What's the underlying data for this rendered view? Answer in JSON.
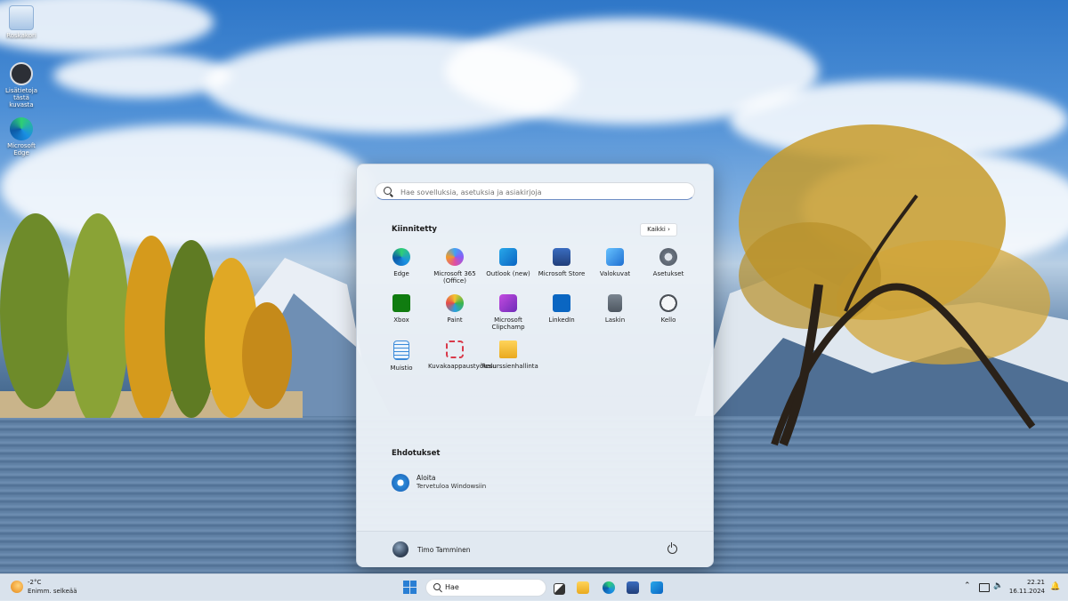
{
  "desktop": {
    "icons": [
      {
        "label": "Roskakori",
        "icon": "recycle-bin-icon"
      },
      {
        "label": "Lisätietoja tästä kuvasta",
        "icon": "info-camera-icon"
      },
      {
        "label": "Microsoft Edge",
        "icon": "edge-icon"
      }
    ]
  },
  "start_menu": {
    "search_placeholder": "Hae sovelluksia, asetuksia ja asiakirjoja",
    "pinned_title": "Kiinnitetty",
    "all_button": "Kaikki  ›",
    "pinned": [
      {
        "label": "Edge",
        "icon": "edge-icon",
        "color": "#1f8fe0"
      },
      {
        "label": "Microsoft 365 (Office)",
        "icon": "office-icon",
        "color": "#8a5cf6"
      },
      {
        "label": "Outlook (new)",
        "icon": "outlook-icon",
        "color": "#0a64c2"
      },
      {
        "label": "Microsoft Store",
        "icon": "store-icon",
        "color": "#2a5aa8"
      },
      {
        "label": "Valokuvat",
        "icon": "photos-icon",
        "color": "#3a8ee6"
      },
      {
        "label": "Asetukset",
        "icon": "settings-icon",
        "color": "#6b7480"
      },
      {
        "label": "Xbox",
        "icon": "xbox-icon",
        "color": "#107c10"
      },
      {
        "label": "Paint",
        "icon": "paint-icon",
        "color": "#2a9fe0"
      },
      {
        "label": "Microsoft Clipchamp",
        "icon": "clipchamp-icon",
        "color": "#a63ad8"
      },
      {
        "label": "LinkedIn",
        "icon": "linkedin-icon",
        "color": "#0a66c2"
      },
      {
        "label": "Laskin",
        "icon": "calculator-icon",
        "color": "#5a6470"
      },
      {
        "label": "Kello",
        "icon": "clock-icon",
        "color": "#4a4f56"
      },
      {
        "label": "Muistio",
        "icon": "notepad-icon",
        "color": "#3b8ad9"
      },
      {
        "label": "Kuvakaappaustyökalu",
        "icon": "snipping-tool-icon",
        "color": "#d9394a"
      },
      {
        "label": "Resurssienhallinta",
        "icon": "file-explorer-icon",
        "color": "#f2c037"
      }
    ],
    "suggestions_title": "Ehdotukset",
    "suggestion": {
      "title": "Aloita",
      "subtitle": "Tervetuloa Windowsiin"
    },
    "user_name": "Timo Tamminen"
  },
  "taskbar": {
    "weather_temp": "-2°C",
    "weather_desc": "Enimm. selkeää",
    "search_label": "Hae",
    "time": "22.21",
    "date": "16.11.2024",
    "apps": [
      "task-view-icon",
      "file-explorer-icon",
      "edge-icon",
      "store-icon",
      "outlook-icon"
    ],
    "accent": "#2a7fd4"
  }
}
